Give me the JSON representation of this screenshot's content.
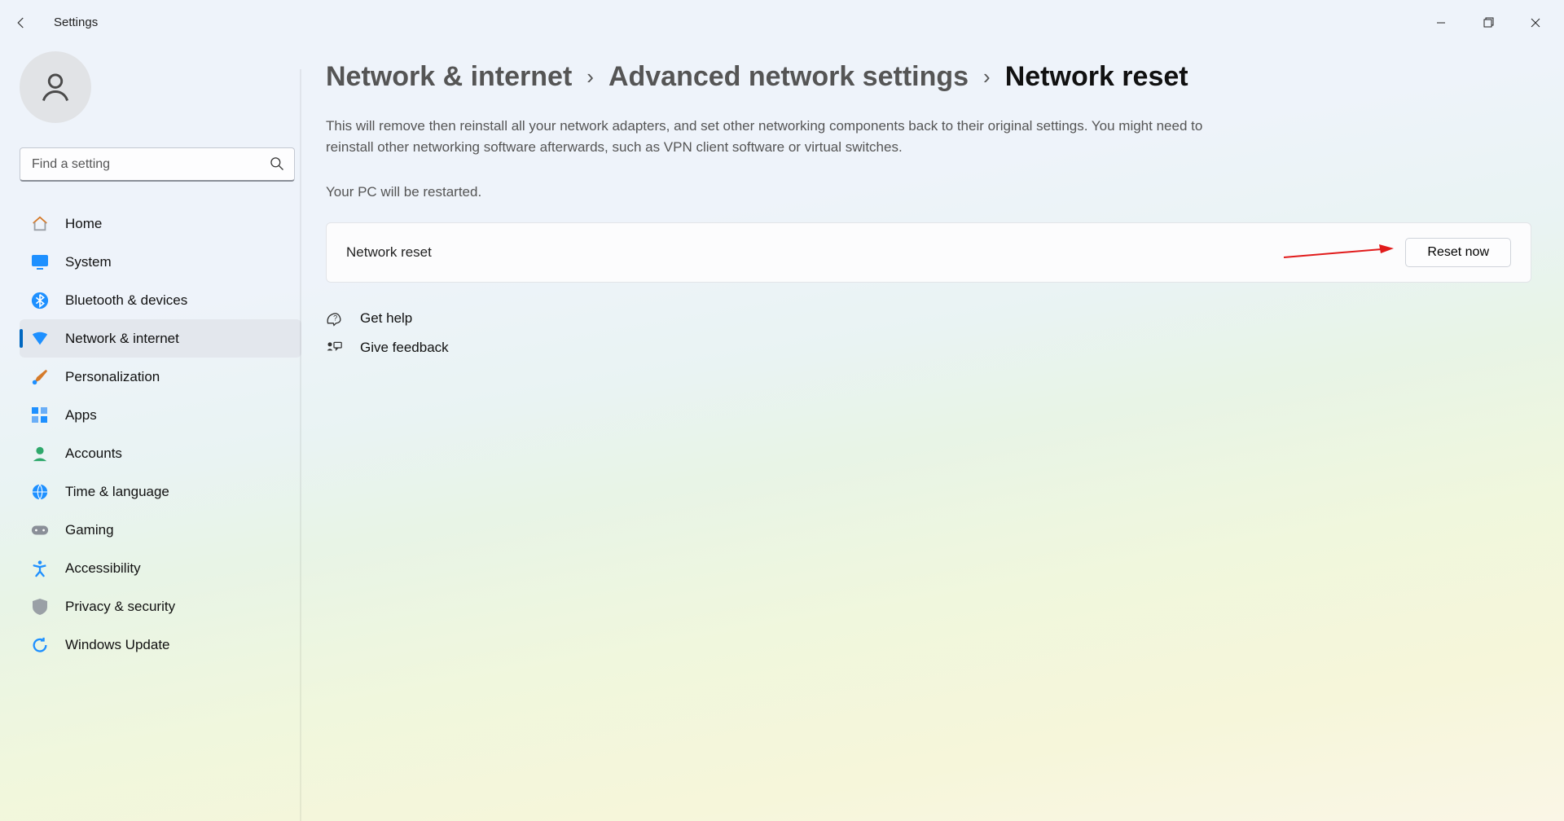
{
  "window": {
    "title": "Settings"
  },
  "search": {
    "placeholder": "Find a setting"
  },
  "sidebar": {
    "items": [
      {
        "id": "home",
        "label": "Home"
      },
      {
        "id": "system",
        "label": "System"
      },
      {
        "id": "bluetooth",
        "label": "Bluetooth & devices"
      },
      {
        "id": "network",
        "label": "Network & internet"
      },
      {
        "id": "personalization",
        "label": "Personalization"
      },
      {
        "id": "apps",
        "label": "Apps"
      },
      {
        "id": "accounts",
        "label": "Accounts"
      },
      {
        "id": "time",
        "label": "Time & language"
      },
      {
        "id": "gaming",
        "label": "Gaming"
      },
      {
        "id": "accessibility",
        "label": "Accessibility"
      },
      {
        "id": "privacy",
        "label": "Privacy & security"
      },
      {
        "id": "update",
        "label": "Windows Update"
      }
    ],
    "active_id": "network"
  },
  "breadcrumb": {
    "items": [
      "Network & internet",
      "Advanced network settings",
      "Network reset"
    ],
    "separator": "›"
  },
  "page": {
    "description_1": "This will remove then reinstall all your network adapters, and set other networking components back to their original settings. You might need to reinstall other networking software afterwards, such as VPN client software or virtual switches.",
    "description_2": "Your PC will be restarted.",
    "card_title": "Network reset",
    "reset_button": "Reset now"
  },
  "help": {
    "get_help": "Get help",
    "feedback": "Give feedback"
  },
  "annotation": {
    "arrow_color": "#e11b1b"
  }
}
